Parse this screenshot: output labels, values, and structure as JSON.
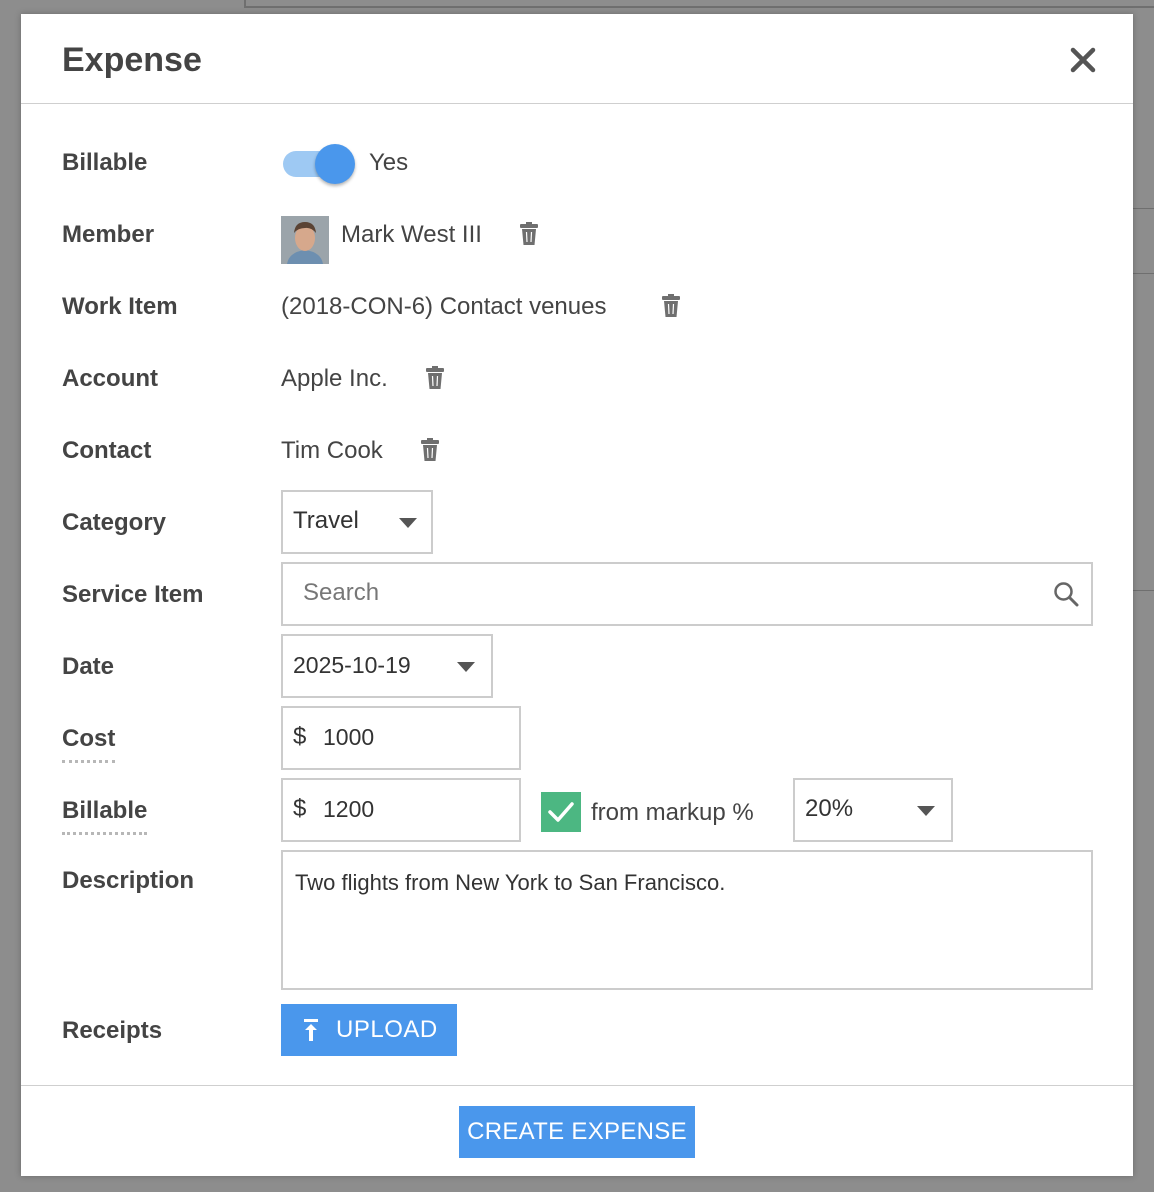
{
  "modal": {
    "title": "Expense"
  },
  "form": {
    "billable_toggle": {
      "label": "Billable",
      "value": "Yes",
      "on": true
    },
    "member": {
      "label": "Member",
      "value": "Mark West III"
    },
    "work_item": {
      "label": "Work Item",
      "value": "(2018-CON-6) Contact venues"
    },
    "account": {
      "label": "Account",
      "value": "Apple Inc."
    },
    "contact": {
      "label": "Contact",
      "value": "Tim Cook"
    },
    "category": {
      "label": "Category",
      "value": "Travel"
    },
    "service_item": {
      "label": "Service Item",
      "placeholder": "Search"
    },
    "date": {
      "label": "Date",
      "value": "2025-10-19"
    },
    "cost": {
      "label": "Cost",
      "currency": "$",
      "value": "1000"
    },
    "billable_amount": {
      "label": "Billable",
      "currency": "$",
      "value": "1200",
      "markup_checked": true,
      "markup_label": "from markup %",
      "markup_value": "20%"
    },
    "description": {
      "label": "Description",
      "value": "Two flights from New York to San Francisco."
    },
    "receipts": {
      "label": "Receipts",
      "upload_label": "UPLOAD"
    }
  },
  "footer": {
    "create_label": "CREATE EXPENSE"
  },
  "icons": {
    "close": "close-icon",
    "trash": "trash-icon",
    "caret": "chevron-down-icon",
    "search": "search-icon",
    "check": "check-icon",
    "upload": "upload-icon"
  },
  "colors": {
    "accent": "#4a97ec",
    "toggle_track": "#9ec9f3",
    "checkbox": "#4cb782",
    "label_text": "#444444",
    "border": "#cccccc",
    "backdrop": "#8d8d8d"
  }
}
